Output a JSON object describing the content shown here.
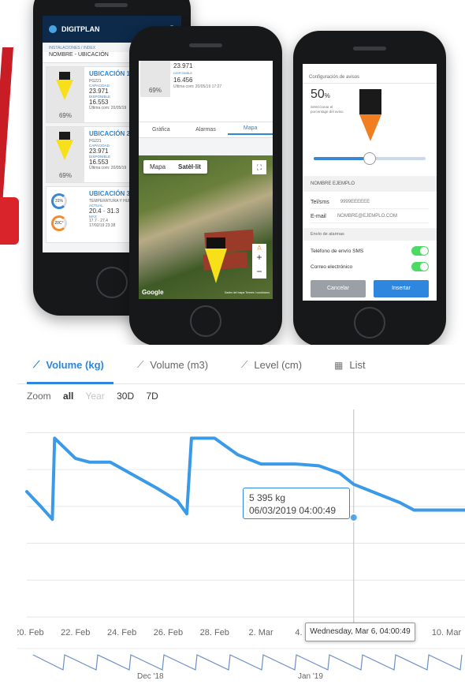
{
  "phone1": {
    "app_name": "DIGITPLAN",
    "refresh_icon": "C",
    "breadcrumb": "INSTALACIONES / INDEX",
    "location_title": "NOMBRE - UBICACIÓN",
    "cards": [
      {
        "title": "UBICACIÓN 1",
        "code": "PG221",
        "cap_label": "CAPACIDAD",
        "capacity": "23.971",
        "disp_label": "DISPONIBLE",
        "available": "16.553",
        "updated": "Última com: 20/05/19",
        "percent": "69%"
      },
      {
        "title": "UBICACIÓN 2",
        "code": "PG221",
        "cap_label": "CAPACIDAD",
        "capacity": "23.971",
        "disp_label": "DISPONIBLE",
        "available": "16.553",
        "updated": "Última com: 20/05/19",
        "percent": "69%"
      },
      {
        "title": "UBICACIÓN 3",
        "subtitle": "TEMPERATURA Y HUM",
        "actual_label": "ACTUAL",
        "actual": "20.4",
        "actual2": "31.3",
        "max_label": "MAX",
        "max": "17.7",
        "max2": "27.4",
        "date": "17/02/19 23:38",
        "gauge1": "31%",
        "gauge2": "20C°"
      }
    ]
  },
  "phone2": {
    "capacity": "23.971",
    "available": "16.456",
    "disp_label": "DISPONIBLE",
    "percent": "69%",
    "updated": "Ultima com: 20/05/19 17:27",
    "tabs": [
      "Gràfica",
      "Alarmas",
      "Mapa"
    ],
    "map_modes": [
      "Mapa",
      "Satèl·lit"
    ],
    "fullscreen_icon": "⛶",
    "zoom_in": "+",
    "zoom_out": "−",
    "google": "Google",
    "terms": "Dades del mapa  Termes i condicions"
  },
  "phone3": {
    "section": "Configuración de avisos",
    "percent_value": "50",
    "percent_sign": "%",
    "selector_text": "Seleccionar el porcentage del aviso",
    "slider_fraction": 0.5,
    "name_header": "NOMBRE EJEMPLO",
    "tel_label": "Tel/sms",
    "tel_value": "9999EEEEEE",
    "email_label": "E-mail",
    "email_value": "NOMBRE@EJEMPLO.COM",
    "alarm_section": "Envío de alarmas",
    "sms_toggle": "Teléfono de envío SMS",
    "mail_toggle": "Correo electrónico",
    "cancel": "Cancelar",
    "insert": "Insertar"
  },
  "chart_tabs": [
    {
      "label": "Volume (kg)",
      "icon": "line-chart-icon",
      "active": true
    },
    {
      "label": "Volume (m3)",
      "icon": "line-chart-icon",
      "active": false
    },
    {
      "label": "Level (cm)",
      "icon": "line-chart-icon",
      "active": false
    },
    {
      "label": "List",
      "icon": "table-icon",
      "active": false
    }
  ],
  "zoom": {
    "label": "Zoom",
    "options": [
      "all",
      "Year",
      "30D",
      "7D"
    ]
  },
  "tooltip": {
    "value": "5 395 kg",
    "date": "06/03/2019 04:00:49"
  },
  "crosshair_label": "Wednesday, Mar 6, 04:00:49",
  "navigator_labels": [
    "Dec '18",
    "Jan '19"
  ],
  "colors": {
    "accent": "#2e86de",
    "series": "#3a9ae8",
    "tank_yellow": "#f7e01a",
    "tank_orange": "#f17f22"
  },
  "chart_data": {
    "type": "line",
    "title": "",
    "xlabel": "",
    "ylabel": "",
    "x_ticks": [
      "20. Feb",
      "22. Feb",
      "24. Feb",
      "26. Feb",
      "28. Feb",
      "2. Mar",
      "4. Mar",
      "6. Mar",
      "8. Mar",
      "10. Mar"
    ],
    "x_range": [
      19.9,
      38.8
    ],
    "y_range": [
      0,
      11000
    ],
    "series": [
      {
        "values": [
          [
            19.9,
            6800
          ],
          [
            20.5,
            6000
          ],
          [
            21.0,
            5300
          ],
          [
            21.1,
            9700
          ],
          [
            22.0,
            8600
          ],
          [
            22.6,
            8400
          ],
          [
            23.5,
            8400
          ],
          [
            24.5,
            7700
          ],
          [
            25.5,
            7000
          ],
          [
            26.4,
            6300
          ],
          [
            26.8,
            5600
          ],
          [
            27.0,
            9700
          ],
          [
            28.0,
            9700
          ],
          [
            29.0,
            8800
          ],
          [
            30.0,
            8300
          ],
          [
            31.5,
            8300
          ],
          [
            32.5,
            8200
          ],
          [
            33.4,
            7800
          ],
          [
            34.0,
            7200
          ],
          [
            35.0,
            6700
          ],
          [
            36.0,
            6200
          ],
          [
            36.6,
            5800
          ],
          [
            37.2,
            5800
          ],
          [
            38.8,
            5800
          ]
        ]
      }
    ],
    "highlight_point": [
      34.0,
      5395
    ],
    "grid": true,
    "legend": "none"
  }
}
